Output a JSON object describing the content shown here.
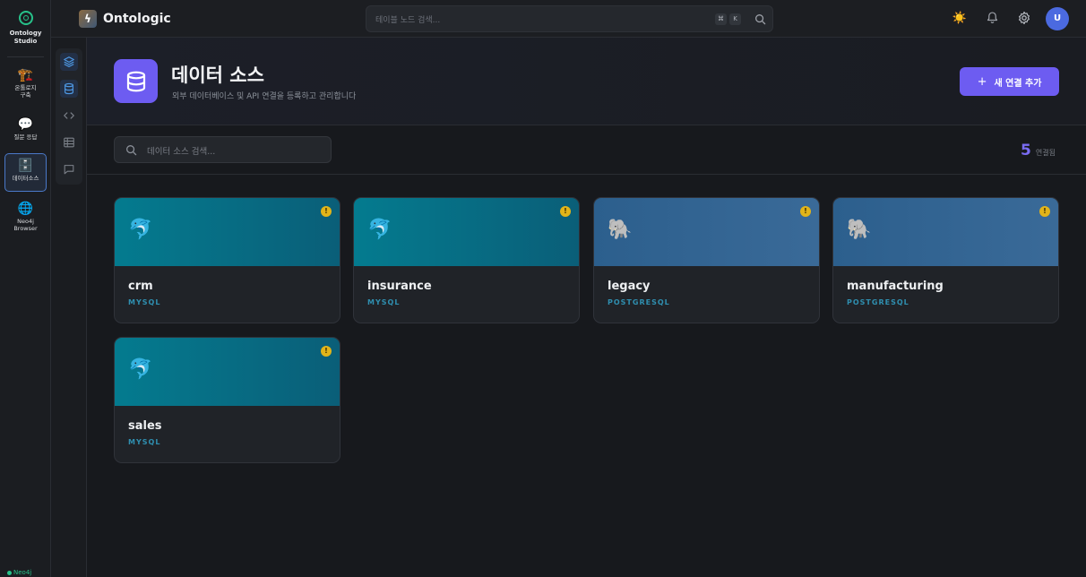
{
  "rail": {
    "logo_title": "Ontology\nStudio",
    "items": [
      {
        "icon": "🏗️",
        "label": "온톨로지\n구축"
      },
      {
        "icon": "💬",
        "label": "질문 응답"
      },
      {
        "icon": "🗄️",
        "label": "데이터소스"
      },
      {
        "icon": "🌐",
        "label": "Neo4j\nBrowser"
      }
    ],
    "status": "Neo4j"
  },
  "header": {
    "brand": "Ontologic",
    "search_placeholder": "테이블 노드 검색...",
    "kbd_cmd": "⌘",
    "kbd_k": "K"
  },
  "page": {
    "title": "데이터 소스",
    "subtitle": "외부 데이터베이스 및 API 연결을 등록하고 관리합니다",
    "add_button": "새 연결 추가",
    "add_icon": "+",
    "search_placeholder": "데이터 소스 검색...",
    "count": "5",
    "count_unit": "연결됨"
  },
  "sources": [
    {
      "name": "crm",
      "type": "MYSQL",
      "icon": "🐬",
      "warn": "!"
    },
    {
      "name": "insurance",
      "type": "MYSQL",
      "icon": "🐬",
      "warn": "!"
    },
    {
      "name": "legacy",
      "type": "POSTGRESQL",
      "icon": "🐘",
      "warn": "!"
    },
    {
      "name": "manufacturing",
      "type": "POSTGRESQL",
      "icon": "🐘",
      "warn": "!"
    },
    {
      "name": "sales",
      "type": "MYSQL",
      "icon": "🐬",
      "warn": "!"
    }
  ],
  "colors": {
    "accent": "#6d5cf1",
    "mysql_banner": "#047b8f",
    "postgres_banner": "#2c5f8d",
    "warning": "#e2b419",
    "status_green": "#27c28a"
  }
}
